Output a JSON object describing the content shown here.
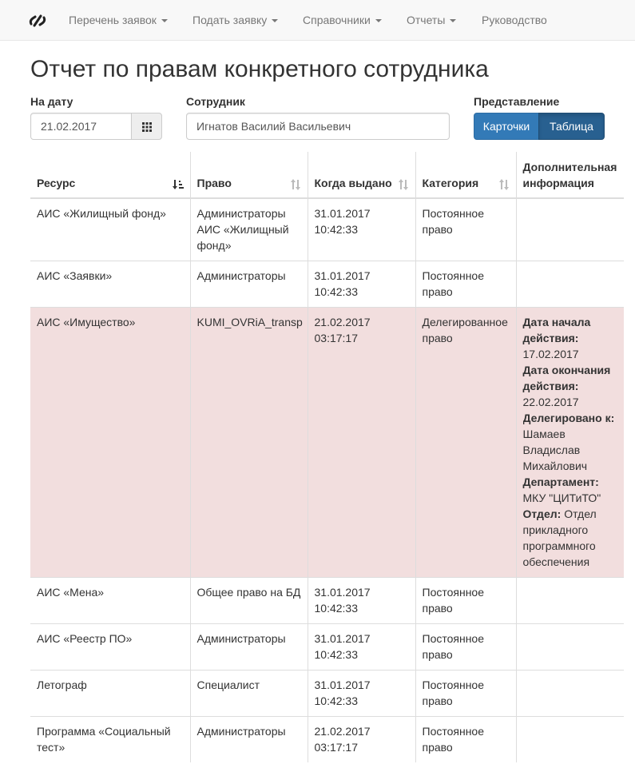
{
  "navbar": {
    "brand_icon": "logo-slash-icon",
    "items": [
      {
        "label": "Перечень заявок",
        "dropdown": true
      },
      {
        "label": "Подать заявку",
        "dropdown": true
      },
      {
        "label": "Справочники",
        "dropdown": true
      },
      {
        "label": "Отчеты",
        "dropdown": true
      },
      {
        "label": "Руководство",
        "dropdown": false
      }
    ]
  },
  "page": {
    "title": "Отчет по правам конкретного сотрудника"
  },
  "filters": {
    "date_label": "На дату",
    "date_value": "21.02.2017",
    "employee_label": "Сотрудник",
    "employee_value": "Игнатов Василий Васильевич",
    "view_label": "Представление",
    "view_cards": "Карточки",
    "view_table": "Таблица",
    "active_view": "Таблица"
  },
  "table": {
    "headers": {
      "resource": "Ресурс",
      "right": "Право",
      "issued": "Когда выдано",
      "category": "Категория",
      "info": "Дополнительная информация"
    },
    "rows": [
      {
        "resource": "АИС «Жилищный фонд»",
        "right": "Администраторы АИС «Жилищный фонд»",
        "issued_date": "31.01.2017",
        "issued_time": "10:42:33",
        "category": "Постоянное право"
      },
      {
        "resource": "АИС «Заявки»",
        "right": "Администраторы",
        "issued_date": "31.01.2017",
        "issued_time": "10:42:33",
        "category": "Постоянное право"
      },
      {
        "resource": "АИС «Имущество»",
        "right": "KUMI_OVRiA_transp",
        "issued_date": "21.02.2017",
        "issued_time": "03:17:17",
        "category": "Делегированное право",
        "info": {
          "start_label": "Дата начала действия:",
          "start_value": "17.02.2017",
          "end_label": "Дата окончания действия:",
          "end_value": "22.02.2017",
          "delegated_label": "Делегировано к:",
          "delegated_value": "Шамаев Владислав Михайлович",
          "dept_label": "Департамент:",
          "dept_value": "МКУ \"ЦИТиТО\"",
          "unit_label": "Отдел:",
          "unit_value": "Отдел прикладного программного обеспечения"
        }
      },
      {
        "resource": "АИС «Мена»",
        "right": "Общее право на БД",
        "issued_date": "31.01.2017",
        "issued_time": "10:42:33",
        "category": "Постоянное право"
      },
      {
        "resource": "АИС «Реестр ПО»",
        "right": "Администраторы",
        "issued_date": "31.01.2017",
        "issued_time": "10:42:33",
        "category": "Постоянное право"
      },
      {
        "resource": "Летограф",
        "right": "Специалист",
        "issued_date": "31.01.2017",
        "issued_time": "10:42:33",
        "category": "Постоянное право"
      },
      {
        "resource": "Программа «Социальный тест»",
        "right": "Администраторы",
        "issued_date": "21.02.2017",
        "issued_time": "03:17:17",
        "category": "Постоянное право"
      }
    ]
  },
  "colors": {
    "primary": "#337ab7",
    "primary_active": "#286090",
    "highlight_row": "#f2dede",
    "navbar_bg": "#f8f8f8"
  }
}
